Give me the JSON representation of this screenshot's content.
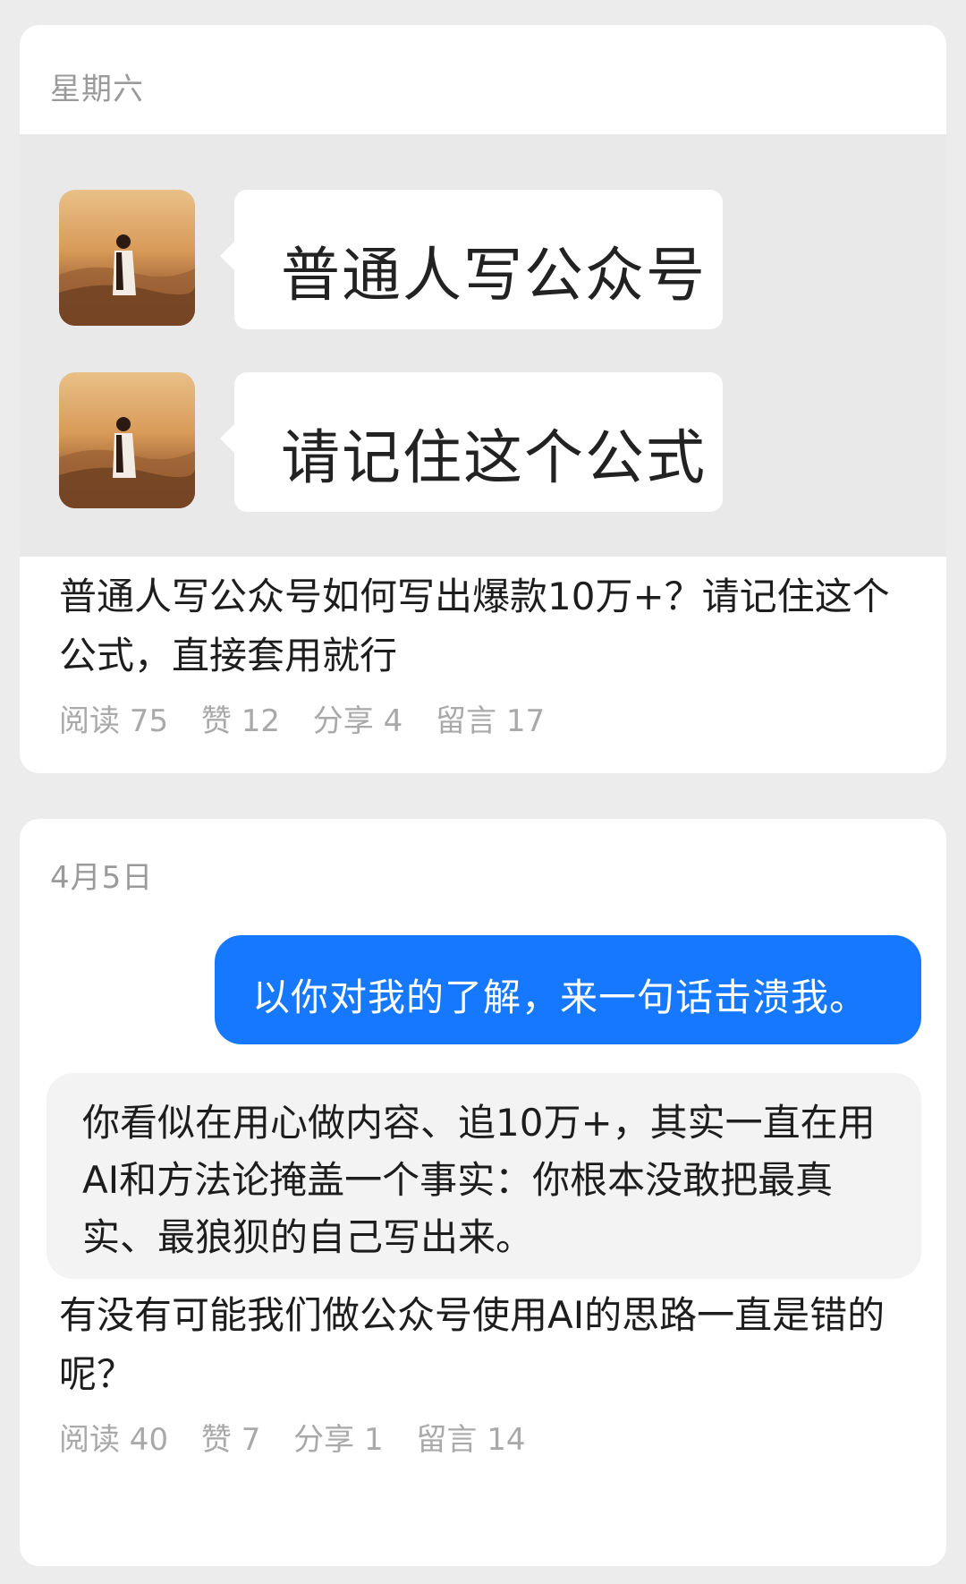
{
  "posts": [
    {
      "date": "星期六",
      "cover_messages": [
        {
          "text": "普通人写公众号"
        },
        {
          "text": "请记住这个公式"
        }
      ],
      "title": "普通人写公众号如何写出爆款10万+？请记住这个公式，直接套用就行",
      "stats": {
        "reads": "阅读 75",
        "likes": "赞 12",
        "shares": "分享 4",
        "comments": "留言 17"
      }
    },
    {
      "date": "4月5日",
      "user_message": "以你对我的了解，来一句话击溃我。",
      "ai_reply": "你看似在用心做内容、追10万+，其实一直在用AI和方法论掩盖一个事实：你根本没敢把最真实、最狼狈的自己写出来。",
      "title": "有没有可能我们做公众号使用AI的思路一直是错的呢？",
      "stats": {
        "reads": "阅读 40",
        "likes": "赞 7",
        "shares": "分享 1",
        "comments": "留言 14"
      }
    }
  ],
  "colors": {
    "background": "#ececec",
    "card": "#ffffff",
    "user_bubble": "#1677ff",
    "ai_bubble": "#f3f3f3",
    "muted_text": "#a9a9a9"
  }
}
